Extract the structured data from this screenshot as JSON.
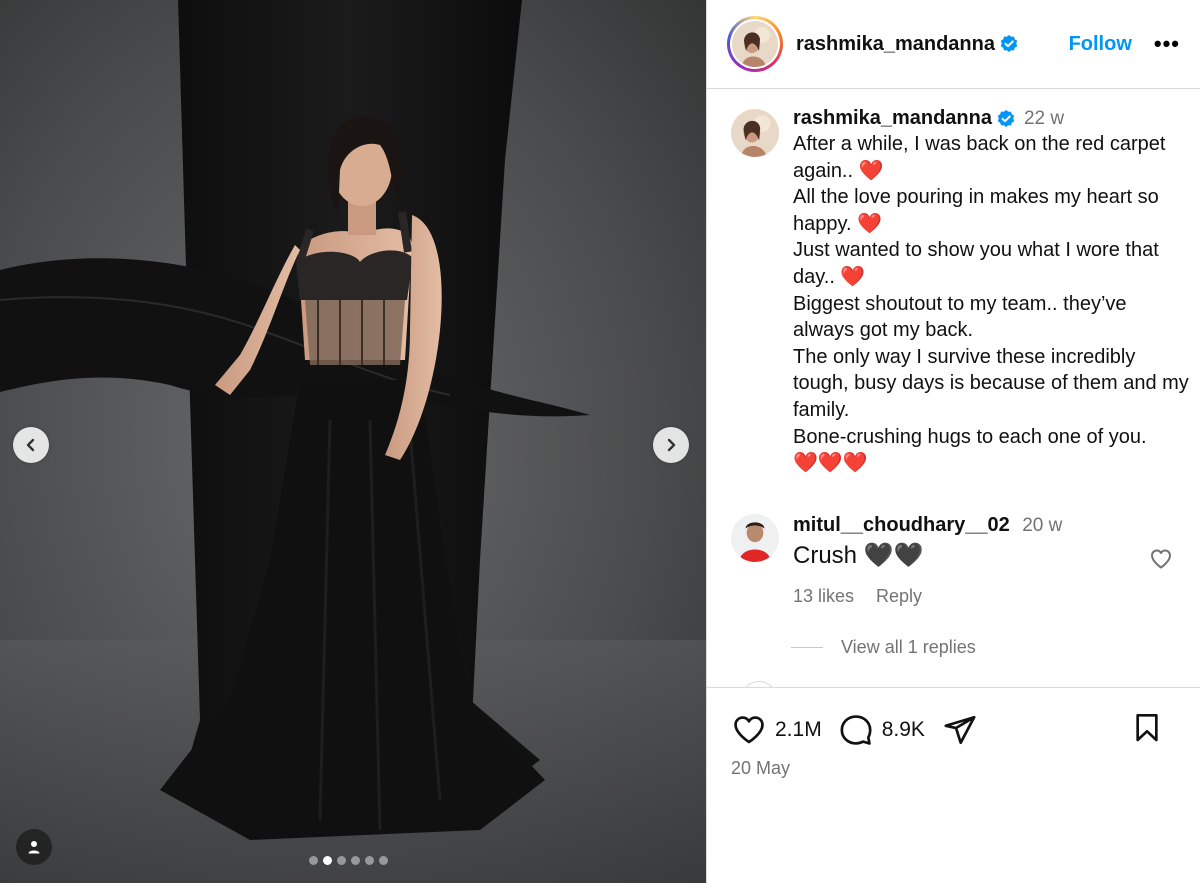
{
  "post": {
    "username": "rashmika_mandanna",
    "follow_label": "Follow",
    "more_label": "•••",
    "carousel": {
      "total": 6,
      "active_index": 1
    }
  },
  "caption": {
    "username": "rashmika_mandanna",
    "time": "22 w",
    "text": "After a while, I was back on the red carpet again.. ❤️\nAll the love pouring in makes my heart so happy. ❤️\nJust wanted to show you what I wore that day.. ❤️\nBiggest shoutout to my team.. they’ve always got my back.\nThe only way I survive these incredibly tough, busy days is because of them and my family.\nBone-crushing hugs to each one of you.\n❤️❤️❤️"
  },
  "comments": [
    {
      "username": "mitul__choudhary__02",
      "time": "20 w",
      "text": "Crush 🖤🖤",
      "likes_label": "13 likes",
      "reply_label": "Reply",
      "view_replies_label": "View all 1 replies"
    }
  ],
  "stats": {
    "likes": "2.1M",
    "comments": "8.9K",
    "date": "20 May"
  },
  "colors": {
    "accent": "#0095f6",
    "verified": "#0095f6",
    "secondary_text": "#737373",
    "divider": "#dbdbdb"
  },
  "icons": {
    "prev": "chevron-left-icon",
    "next": "chevron-right-icon",
    "tag": "user-tag-icon",
    "like": "heart-icon",
    "comment": "comment-icon",
    "share": "paper-plane-icon",
    "save": "bookmark-icon"
  }
}
